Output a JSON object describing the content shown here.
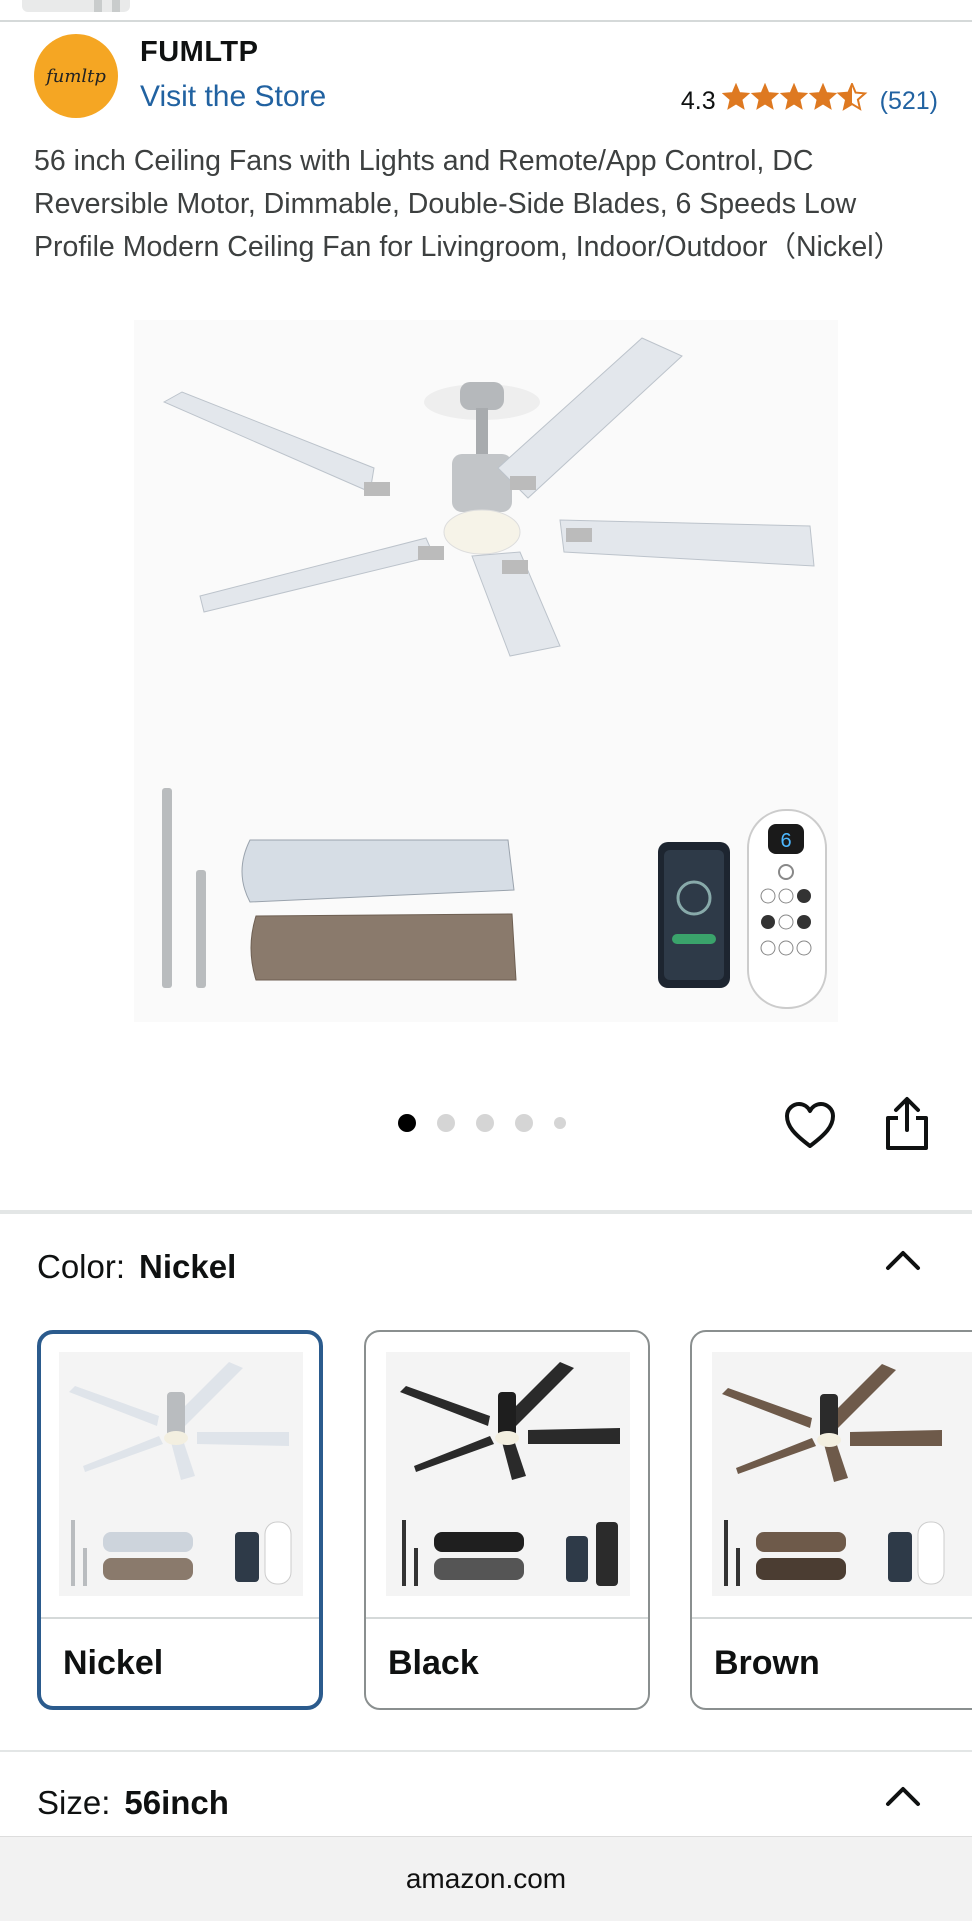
{
  "store": {
    "logo_text": "fumltp",
    "name": "FUMLTP",
    "visit_label": "Visit the Store",
    "rating_value": "4.3",
    "rating_stars": 4.3,
    "rating_count": "(521)",
    "star_color": "#de7921"
  },
  "product": {
    "title": "56 inch Ceiling Fans with Lights and Remote/App Control, DC Reversible Motor, Dimmable, Double-Side Blades, 6 Speeds Low Profile Modern Ceiling Fan for Livingroom, Indoor/Outdoor（Nickel）",
    "image_count": 5,
    "active_image": 1,
    "remote_display": "6"
  },
  "actions": {
    "wishlist_icon": "heart-icon",
    "share_icon": "share-icon"
  },
  "color": {
    "label": "Color:",
    "selected": "Nickel",
    "options": [
      {
        "name": "Nickel",
        "blade": "#cdd4dc",
        "body": "#b9bcbf"
      },
      {
        "name": "Black",
        "blade": "#2a2a2a",
        "body": "#1e1e1e"
      },
      {
        "name": "Brown",
        "blade": "#6e5a4a",
        "body": "#2b2b2b"
      }
    ],
    "selected_border": "#2b5b8d"
  },
  "size": {
    "label": "Size:",
    "selected": "56inch"
  },
  "browser": {
    "url": "amazon.com"
  },
  "colors": {
    "link": "#2162a1",
    "brand_bg": "#f5a623"
  }
}
